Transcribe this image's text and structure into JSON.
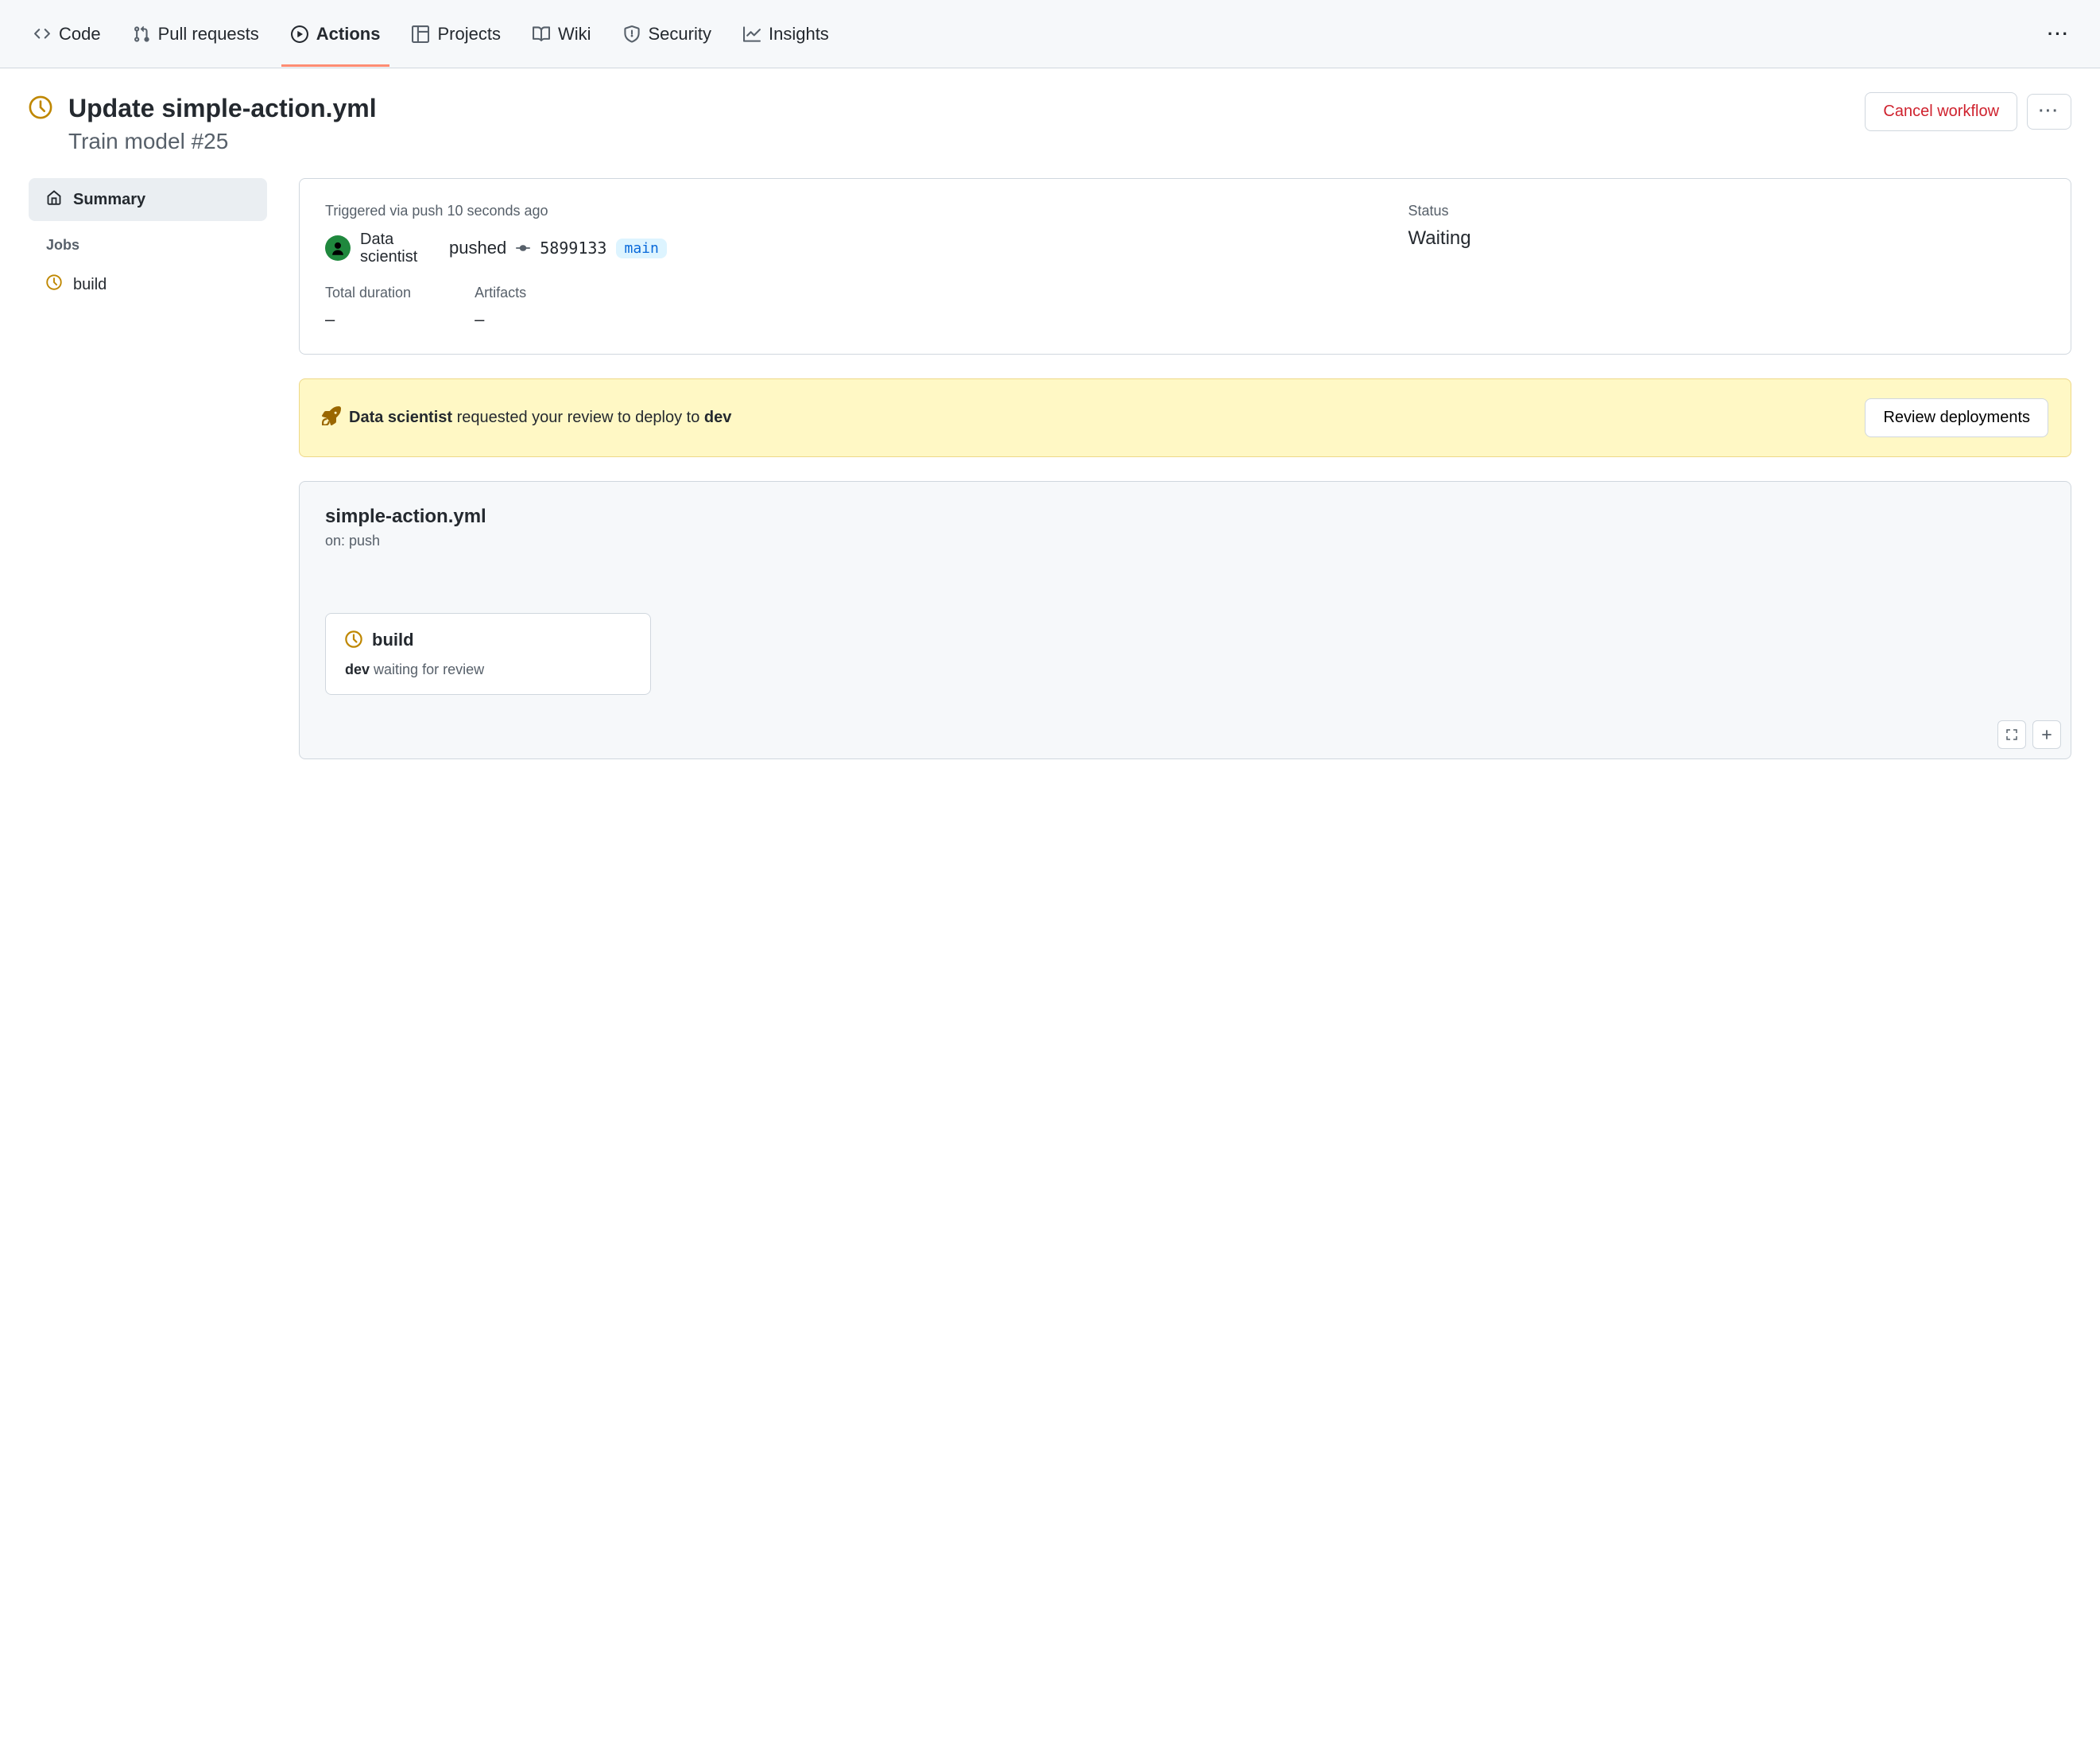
{
  "nav": {
    "items": [
      {
        "label": "Code",
        "icon": "code-icon"
      },
      {
        "label": "Pull requests",
        "icon": "pull-request-icon"
      },
      {
        "label": "Actions",
        "icon": "play-icon",
        "active": true
      },
      {
        "label": "Projects",
        "icon": "table-icon"
      },
      {
        "label": "Wiki",
        "icon": "book-icon"
      },
      {
        "label": "Security",
        "icon": "shield-icon"
      },
      {
        "label": "Insights",
        "icon": "graph-icon"
      }
    ]
  },
  "header": {
    "title": "Update simple-action.yml",
    "subtitle": "Train model #25",
    "cancel_label": "Cancel workflow"
  },
  "sidebar": {
    "summary_label": "Summary",
    "jobs_heading": "Jobs",
    "jobs": [
      {
        "label": "build"
      }
    ]
  },
  "summary": {
    "trigger_prefix": "Triggered via push",
    "trigger_time": "10 seconds ago",
    "actor": "Data scientist",
    "action_word": "pushed",
    "sha": "5899133",
    "branch": "main",
    "status_label": "Status",
    "status_value": "Waiting",
    "duration_label": "Total duration",
    "duration_value": "–",
    "artifacts_label": "Artifacts",
    "artifacts_value": "–"
  },
  "review": {
    "actor": "Data scientist",
    "message": " requested your review to deploy to ",
    "env": "dev",
    "button_label": "Review deployments"
  },
  "workflow": {
    "file_name": "simple-action.yml",
    "trigger_text": "on: push",
    "job": {
      "name": "build",
      "env": "dev",
      "status_text": " waiting for review"
    }
  }
}
